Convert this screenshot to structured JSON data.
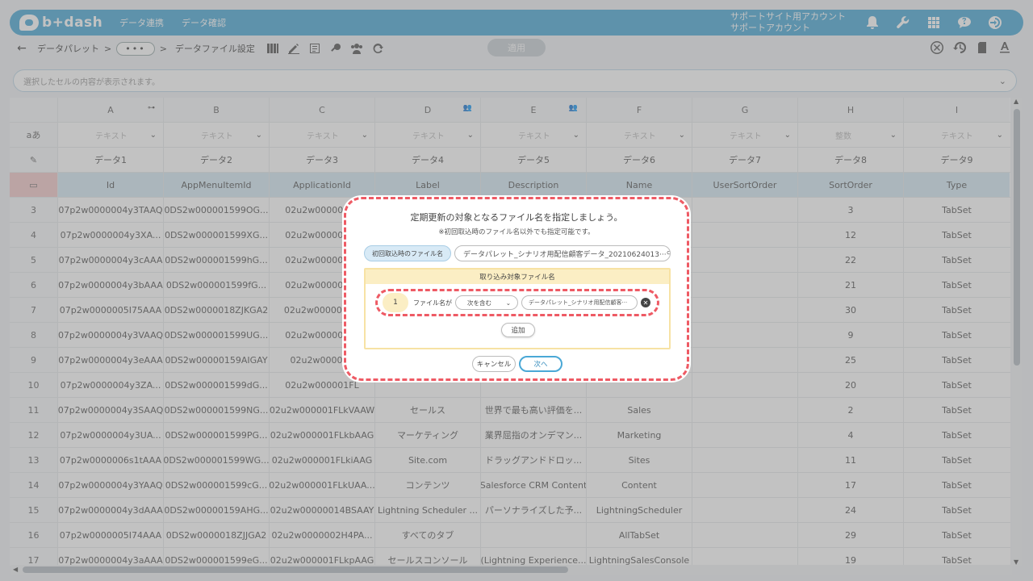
{
  "app": {
    "logo_text": "b+dash",
    "nav": [
      "データ連携",
      "データ確認"
    ],
    "account_line1": "サポートサイト用アカウント",
    "account_line2": "サポートアカウント"
  },
  "toolbar": {
    "breadcrumb_root": "データパレット",
    "breadcrumb_more": "•••",
    "breadcrumb_current": "データファイル設定",
    "apply_label": "適用",
    "sep": ">"
  },
  "cellbar": {
    "placeholder": "選択したセルの内容が表示されます。"
  },
  "grid": {
    "row_header_labels": {
      "filter": "aあ"
    },
    "columns": [
      "A",
      "B",
      "C",
      "D",
      "E",
      "F",
      "G",
      "H",
      "I"
    ],
    "filters": [
      "テキスト",
      "テキスト",
      "テキスト",
      "テキスト",
      "テキスト",
      "テキスト",
      "テキスト",
      "整数",
      "テキスト"
    ],
    "labels": [
      "データ1",
      "データ2",
      "データ3",
      "データ4",
      "データ5",
      "データ6",
      "データ7",
      "データ8",
      "データ9"
    ],
    "fields": [
      "Id",
      "AppMenuItemId",
      "ApplicationId",
      "Label",
      "Description",
      "Name",
      "UserSortOrder",
      "SortOrder",
      "Type"
    ],
    "rows": [
      [
        "3",
        "07p2w0000004y3TAAQ",
        "0DS2w000001599OG...",
        "02u2w000001FL",
        "",
        "",
        "",
        "",
        "3",
        "TabSet"
      ],
      [
        "4",
        "07p2w0000004y3XA...",
        "0DS2w000001599XG...",
        "02u2w000001FL",
        "",
        "",
        "",
        "",
        "12",
        "TabSet"
      ],
      [
        "5",
        "07p2w0000004y3cAAA",
        "0DS2w000001599hG...",
        "02u2w000001FL",
        "",
        "",
        "",
        "",
        "22",
        "TabSet"
      ],
      [
        "6",
        "07p2w0000004y3bAAA",
        "0DS2w000001599fG...",
        "02u2w000001FL",
        "",
        "",
        "",
        "",
        "21",
        "TabSet"
      ],
      [
        "7",
        "07p2w0000005I75AAA",
        "0DS2w0000018ZJKGA2",
        "02u2w0000002H",
        "",
        "",
        "",
        "",
        "30",
        "TabSet"
      ],
      [
        "8",
        "07p2w0000004y3VAAQ",
        "0DS2w000001599UG...",
        "02u2w000001FL",
        "",
        "",
        "",
        "",
        "9",
        "TabSet"
      ],
      [
        "9",
        "07p2w0000004y3eAAA",
        "0DS2w00000159AIGAY",
        "02u2w000001",
        "",
        "",
        "",
        "",
        "25",
        "TabSet"
      ],
      [
        "10",
        "07p2w0000004y3ZA...",
        "0DS2w000001599dG...",
        "02u2w000001FL",
        "",
        "",
        "",
        "",
        "20",
        "TabSet"
      ],
      [
        "11",
        "07p2w0000004y3SAAQ",
        "0DS2w000001599NG...",
        "02u2w000001FLkVAAW",
        "セールス",
        "世界で最も高い評価を...",
        "Sales",
        "",
        "2",
        "TabSet"
      ],
      [
        "12",
        "07p2w0000004y3UA...",
        "0DS2w000001599PG...",
        "02u2w000001FLkbAAG",
        "マーケティング",
        "業界屈指のオンデマン...",
        "Marketing",
        "",
        "4",
        "TabSet"
      ],
      [
        "13",
        "07p2w0000006s1tAAA",
        "0DS2w000001599WG...",
        "02u2w000001FLkiAAG",
        "Site.com",
        "ドラッグアンドドロッ...",
        "Sites",
        "",
        "11",
        "TabSet"
      ],
      [
        "14",
        "07p2w0000004y3YAAQ",
        "0DS2w000001599cG...",
        "02u2w000001FLkUAA...",
        "コンテンツ",
        "Salesforce CRM Content",
        "Content",
        "",
        "17",
        "TabSet"
      ],
      [
        "15",
        "07p2w0000004y3dAAA",
        "0DS2w00000159AHG...",
        "02u2w00000014BSAAY",
        "Lightning Scheduler ...",
        "パーソナライズした予...",
        "LightningScheduler",
        "",
        "24",
        "TabSet"
      ],
      [
        "16",
        "07p2w0000005I74AAA",
        "0DS2w0000018ZJJGA2",
        "02u2w0000002H4PA...",
        "すべてのタブ",
        "",
        "AllTabSet",
        "",
        "29",
        "TabSet"
      ],
      [
        "17",
        "07p2w0000004y3aAAA",
        "0DS2w000001599eG...",
        "02u2w000001FLkpAAG",
        "セールスコンソール",
        "(Lightning Experience...",
        "LightningSalesConsole",
        "",
        "19",
        "TabSet"
      ]
    ]
  },
  "modal": {
    "title": "定期更新の対象となるファイル名を指定しましょう。",
    "subtitle": "※初回取込時のファイル名以外でも指定可能です。",
    "initial_label": "初回取込時のファイル名",
    "initial_value": "データパレット_シナリオ用配信顧客データ_20210624013···",
    "box_title": "取り込み対象ファイル名",
    "condition": {
      "index": "1",
      "label": "ファイル名が",
      "operator": "次を含む",
      "value": "データパレット_シナリオ用配信顧客···"
    },
    "add_label": "追加",
    "cancel_label": "キャンセル",
    "next_label": "次へ"
  },
  "colors": {
    "accent": "#4aa8d6",
    "highlight": "#ee5a64",
    "field_row": "#d5eaf5",
    "box": "#fbeec4"
  }
}
